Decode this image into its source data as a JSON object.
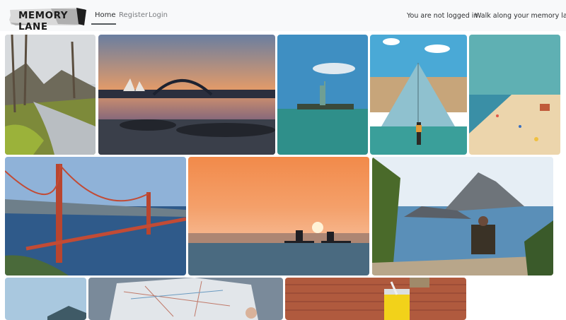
{
  "brand": {
    "name": "MEMORY LANE"
  },
  "nav": {
    "home": "Home",
    "register": "Register",
    "login": "Login"
  },
  "status": {
    "login_state": "You are not logged in",
    "tagline": "Walk along your memory lane..."
  },
  "photos": [
    {
      "subject": "forest-stream"
    },
    {
      "subject": "sydney-opera-house-harbour-bridge"
    },
    {
      "subject": "statue-of-liberty"
    },
    {
      "subject": "louvre-pyramid"
    },
    {
      "subject": "crowded-beach"
    },
    {
      "subject": "golden-gate-bridge"
    },
    {
      "subject": "sunset-paddleboarders"
    },
    {
      "subject": "man-viewing-island-rocks"
    },
    {
      "subject": "mountain-lake"
    },
    {
      "subject": "road-map"
    },
    {
      "subject": "juice-glass-brick-wall"
    }
  ]
}
